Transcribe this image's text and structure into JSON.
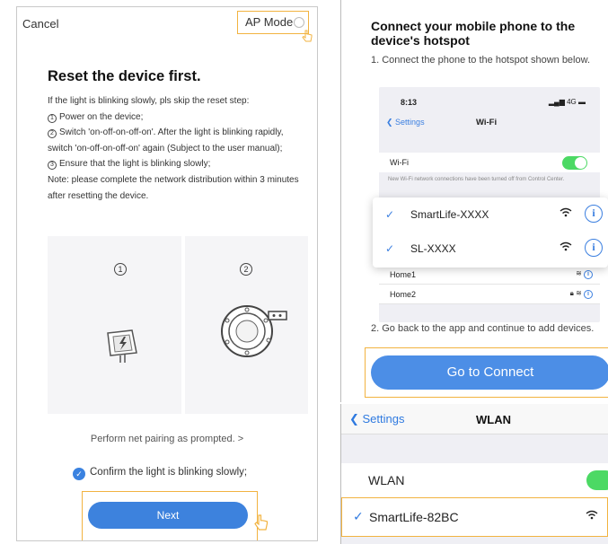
{
  "left": {
    "cancel": "Cancel",
    "ap_mode": "AP Mode",
    "title": "Reset the device first.",
    "instructions": [
      "If the light is blinking slowly, pls skip the reset step:",
      "Power on the device;",
      "Switch 'on-off-on-off-on'. After the light is blinking rapidly, switch 'on-off-on-off-on' again (Subject to the user manual);",
      "Ensure that the light is blinking slowly;",
      "Note: please complete the network distribution within 3 minutes after resetting the device."
    ],
    "step_nums": [
      "1",
      "2",
      "3"
    ],
    "illu_step1": "1",
    "illu_step2": "2",
    "net_pairing": "Perform net pairing as prompted. >",
    "confirm": "Confirm the light is blinking slowly;",
    "next": "Next"
  },
  "right": {
    "title": "Connect your mobile phone to the device's hotspot",
    "step1": "1. Connect the phone to the hotspot shown below.",
    "phone": {
      "time": "8:13",
      "status": "4G",
      "back": "Settings",
      "wifi_title": "Wi-Fi",
      "wifi_label": "Wi-Fi",
      "note": "New Wi-Fi network connections have been turned off from Control Center.",
      "networks": [
        "Home1",
        "Home2"
      ]
    },
    "hotspots": [
      "SmartLife-XXXX",
      "SL-XXXX"
    ],
    "step2": "2. Go back to the app and continue to add devices.",
    "go_connect": "Go to Connect"
  },
  "wlan": {
    "back": "Settings",
    "title": "WLAN",
    "label": "WLAN",
    "network": "SmartLife-82BC"
  },
  "colors": {
    "accent_blue": "#3d82dd",
    "highlight_orange": "#f2b340",
    "toggle_green": "#4cd964"
  }
}
